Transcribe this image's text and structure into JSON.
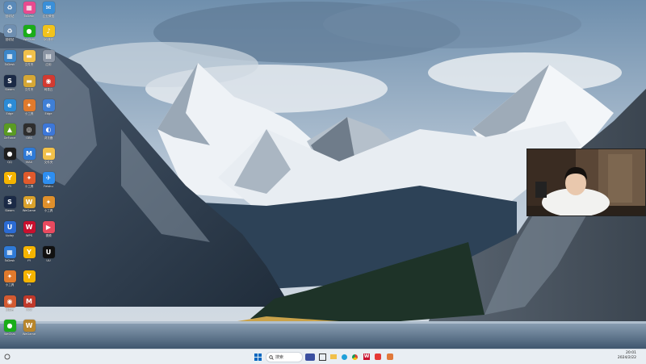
{
  "desktop": {
    "icons": [
      {
        "label": "回收站",
        "glyph": "♻",
        "color": "#5b8ab8"
      },
      {
        "label": "ToDesk",
        "glyph": "▦",
        "color": "#2f7ad6"
      },
      {
        "label": "企业微信",
        "glyph": "✉",
        "color": "#3a8fd8"
      },
      {
        "label": "WeChat",
        "glyph": "●",
        "color": "#1aad19"
      },
      {
        "label": "网易云",
        "glyph": "◉",
        "color": "#d33a31"
      },
      {
        "label": "GeForce",
        "glyph": "▲",
        "color": "#5a9b23"
      },
      {
        "label": "QQ",
        "glyph": "●",
        "color": "#1e1e1e"
      },
      {
        "label": "Edge",
        "glyph": "e",
        "color": "#2b8bd6"
      },
      {
        "label": "QQ音乐",
        "glyph": "♪",
        "color": "#f2c31b"
      },
      {
        "label": "OBS",
        "glyph": "◎",
        "color": "#2e2e2e"
      },
      {
        "label": "Steam",
        "glyph": "S",
        "color": "#1b2a46"
      },
      {
        "label": "WeGame",
        "glyph": "W",
        "color": "#d9a12c"
      },
      {
        "label": "小工具",
        "glyph": "✦",
        "color": "#e07a2c"
      },
      {
        "label": "ToDesk",
        "glyph": "▦",
        "color": "#2f7ad6"
      },
      {
        "label": "MAX",
        "glyph": "M",
        "color": "#c0392b"
      },
      {
        "label": "视频",
        "glyph": "▶",
        "color": "#e84a5f"
      },
      {
        "label": "Feishu",
        "glyph": "✈",
        "color": "#2e8ef0"
      },
      {
        "label": "YY",
        "glyph": "Y",
        "color": "#f5b400"
      },
      {
        "label": "文件夹",
        "glyph": "▬",
        "color": "#f1c04a"
      },
      {
        "label": "浏览器",
        "glyph": "◐",
        "color": "#3d77d8"
      },
      {
        "label": "WPS",
        "glyph": "W",
        "color": "#c8102e"
      },
      {
        "label": "UU",
        "glyph": "U",
        "color": "#111111"
      },
      {
        "label": "Uplay",
        "glyph": "U",
        "color": "#2b6bd3"
      },
      {
        "label": "应用",
        "glyph": "▤",
        "color": "#5e6b7a"
      }
    ]
  },
  "webcam": {
    "description_icon": "webcam-overlay"
  },
  "taskbar": {
    "search_placeholder": "搜索",
    "clock_time": "20:01",
    "clock_date": "2024/2/22"
  },
  "colors": {
    "taskbar_bg": "#e9eef3",
    "accent": "#0067c0"
  }
}
